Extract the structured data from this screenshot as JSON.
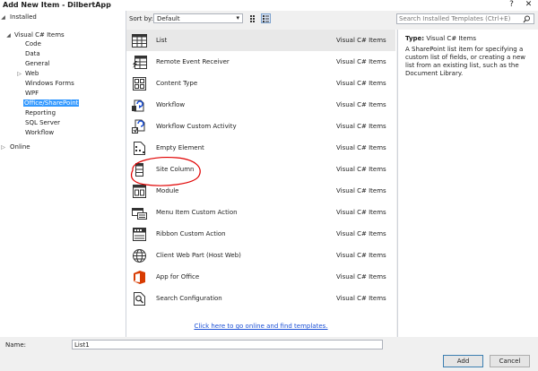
{
  "window": {
    "title": "Add New Item - DilbertApp",
    "help_label": "?",
    "close_label": "✕"
  },
  "tree": {
    "installed_label": "Installed",
    "root_label": "Visual C# Items",
    "children": [
      "Code",
      "Data",
      "General",
      "Web",
      "Windows Forms",
      "WPF",
      "Office/SharePoint",
      "Reporting",
      "SQL Server",
      "Workflow"
    ],
    "selected": "Office/SharePoint",
    "online_label": "Online"
  },
  "toolbar": {
    "sort_label": "Sort by:",
    "sort_value": "Default",
    "search_placeholder": "Search Installed Templates (Ctrl+E)"
  },
  "items": [
    {
      "name": "List",
      "category": "Visual C# Items",
      "icon": "list-icon"
    },
    {
      "name": "Remote Event Receiver",
      "category": "Visual C# Items",
      "icon": "remote-event-receiver-icon"
    },
    {
      "name": "Content Type",
      "category": "Visual C# Items",
      "icon": "content-type-icon"
    },
    {
      "name": "Workflow",
      "category": "Visual C# Items",
      "icon": "workflow-icon"
    },
    {
      "name": "Workflow Custom Activity",
      "category": "Visual C# Items",
      "icon": "workflow-activity-icon"
    },
    {
      "name": "Empty Element",
      "category": "Visual C# Items",
      "icon": "empty-element-icon"
    },
    {
      "name": "Site Column",
      "category": "Visual C# Items",
      "icon": "site-column-icon"
    },
    {
      "name": "Module",
      "category": "Visual C# Items",
      "icon": "module-icon"
    },
    {
      "name": "Menu Item Custom Action",
      "category": "Visual C# Items",
      "icon": "menu-action-icon"
    },
    {
      "name": "Ribbon Custom Action",
      "category": "Visual C# Items",
      "icon": "ribbon-action-icon"
    },
    {
      "name": "Client Web Part (Host Web)",
      "category": "Visual C# Items",
      "icon": "web-part-icon"
    },
    {
      "name": "App for Office",
      "category": "Visual C# Items",
      "icon": "office-app-icon"
    },
    {
      "name": "Search Configuration",
      "category": "Visual C# Items",
      "icon": "search-config-icon"
    }
  ],
  "selected_item": "List",
  "online_link": "Click here to go online and find templates.",
  "details": {
    "type_label": "Type:",
    "type_value": "Visual C# Items",
    "description": "A SharePoint list item for specifying a custom list of fields, or creating a new list from an existing list, such as the Document Library."
  },
  "footer": {
    "name_label": "Name:",
    "name_value": "List1",
    "add_label": "Add",
    "cancel_label": "Cancel"
  },
  "colors": {
    "selection": "#3399ff",
    "annotation": "#e00000",
    "link": "#1a4fd6",
    "office_orange": "#d83b01"
  }
}
